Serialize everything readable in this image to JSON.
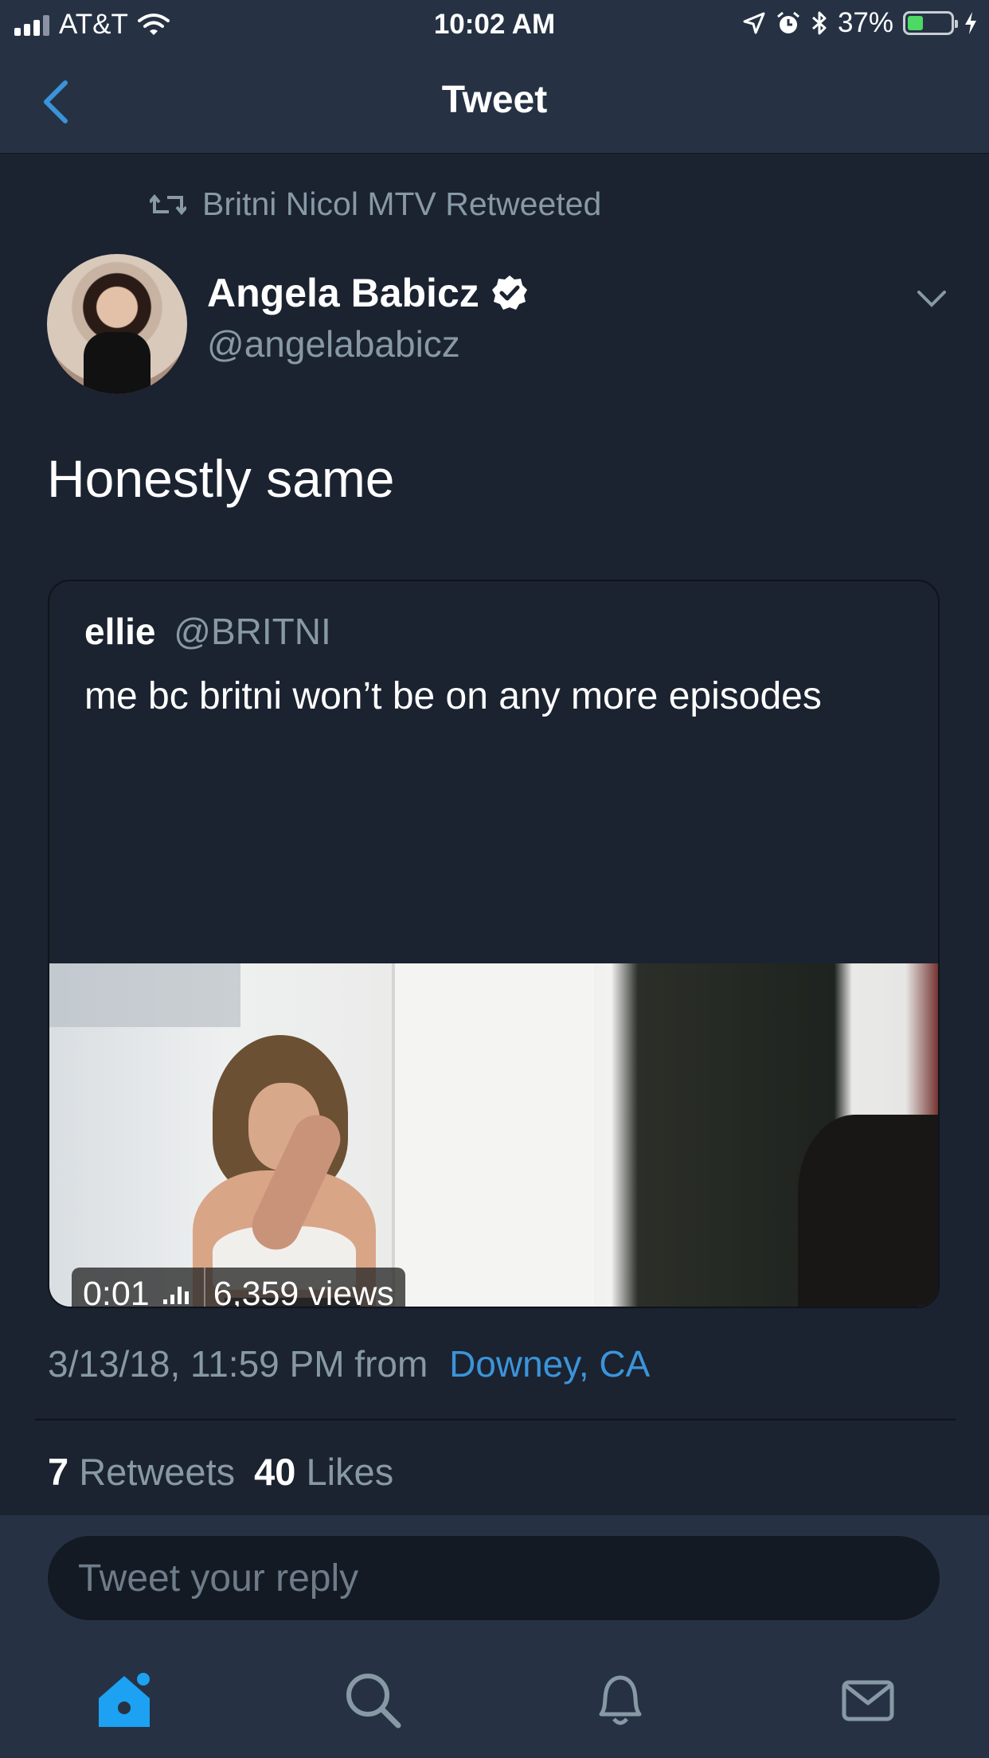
{
  "status_bar": {
    "carrier": "AT&T",
    "time": "10:02 AM",
    "battery": "37%",
    "battery_level": 0.37,
    "icons": [
      "signal-icon",
      "wifi-icon",
      "location-icon",
      "alarm-icon",
      "bluetooth-icon",
      "battery-icon",
      "charging-icon"
    ]
  },
  "nav": {
    "title": "Tweet",
    "back_icon": "chevron-left-icon"
  },
  "tweet": {
    "retweeted_by": "Britni Nicol MTV Retweeted",
    "author_name": "Angela Babicz",
    "author_handle": "@angelababicz",
    "text": "Honestly same",
    "timestamp": "3/13/18, 11:59 PM",
    "from_label": "from",
    "location": "Downey, CA",
    "retweets_count": "7",
    "retweets_label": "Retweets",
    "likes_count": "40",
    "likes_label": "Likes"
  },
  "quoted_tweet": {
    "author_name": "ellie",
    "author_handle": "@BRITNI",
    "text": "me bc britni won’t be on any more episodes",
    "video": {
      "duration": "0:01",
      "views": "6,359 views"
    }
  },
  "reply": {
    "placeholder": "Tweet your reply"
  },
  "tab_bar": {
    "tabs": [
      "home-icon",
      "search-icon",
      "notifications-icon",
      "messages-icon"
    ],
    "active": "home-icon",
    "accent_color": "#1da1f2"
  },
  "colors": {
    "background": "#1b2230",
    "bar": "#263244",
    "secondary_text": "#8899a6",
    "link": "#3b94d9"
  }
}
